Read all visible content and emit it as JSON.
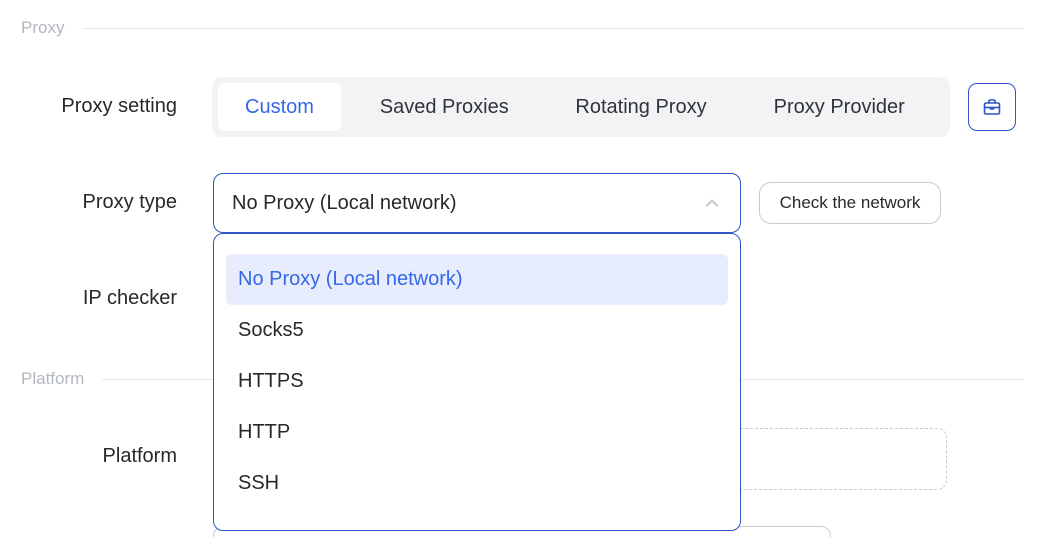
{
  "sections": {
    "proxy": "Proxy",
    "platform": "Platform"
  },
  "labels": {
    "proxy_setting": "Proxy setting",
    "proxy_type": "Proxy type",
    "ip_checker": "IP checker",
    "platform": "Platform"
  },
  "proxy_setting_tabs": [
    {
      "label": "Custom",
      "active": true
    },
    {
      "label": "Saved Proxies",
      "active": false
    },
    {
      "label": "Rotating Proxy",
      "active": false
    },
    {
      "label": "Proxy Provider",
      "active": false
    }
  ],
  "proxy_setting_icon": "bag-icon",
  "proxy_type_select": {
    "value": "No Proxy (Local network)",
    "icon": "chevron-up-icon",
    "open": true
  },
  "check_network_label": "Check the network",
  "proxy_type_options": [
    {
      "label": "No Proxy (Local network)",
      "selected": true
    },
    {
      "label": "Socks5",
      "selected": false
    },
    {
      "label": "HTTPS",
      "selected": false
    },
    {
      "label": "HTTP",
      "selected": false
    },
    {
      "label": "SSH",
      "selected": false
    }
  ],
  "colors": {
    "accent": "#3468e8",
    "border_active": "#2f55c4",
    "selected_bg": "#e8edfd",
    "segment_bg": "#f2f3f5"
  }
}
